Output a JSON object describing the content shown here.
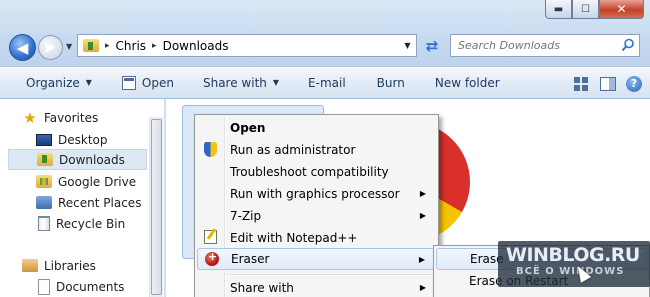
{
  "window": {
    "controls": {
      "minimize": "▬",
      "maximize": "☐",
      "close": "✕"
    }
  },
  "navigation": {
    "back": "◀",
    "forward": "▶",
    "history_dropdown": "▼"
  },
  "address": {
    "separator": "▸",
    "crumbs": [
      "Chris",
      "Downloads"
    ],
    "dropdown": "▼",
    "refresh": "⇄"
  },
  "search": {
    "placeholder": "Search Downloads"
  },
  "toolbar": {
    "organize_label": "Organize",
    "open_label": "Open",
    "share_with_label": "Share with",
    "email_label": "E-mail",
    "burn_label": "Burn",
    "new_folder_label": "New folder",
    "caret": "▼",
    "help": "?"
  },
  "sidebar": {
    "favorites_label": "Favorites",
    "items": [
      {
        "label": "Desktop"
      },
      {
        "label": "Downloads"
      },
      {
        "label": "Google Drive"
      },
      {
        "label": "Recent Places"
      },
      {
        "label": "Recycle Bin"
      }
    ],
    "libraries_label": "Libraries",
    "library_items": [
      {
        "label": "Documents"
      }
    ]
  },
  "context_menu": {
    "items": [
      {
        "label": "Open"
      },
      {
        "label": "Run as administrator"
      },
      {
        "label": "Troubleshoot compatibility"
      },
      {
        "label": "Run with graphics processor"
      },
      {
        "label": "7-Zip"
      },
      {
        "label": "Edit with Notepad++"
      },
      {
        "label": "Eraser"
      },
      {
        "label": "Share with"
      }
    ],
    "submenu_arrow": "▶"
  },
  "submenu": {
    "items": [
      {
        "label": "Erase"
      },
      {
        "label": "Erase on Restart"
      }
    ]
  },
  "watermark": {
    "title": "WINBLOG.RU",
    "subtitle": "ВСЁ О WINDOWS"
  }
}
